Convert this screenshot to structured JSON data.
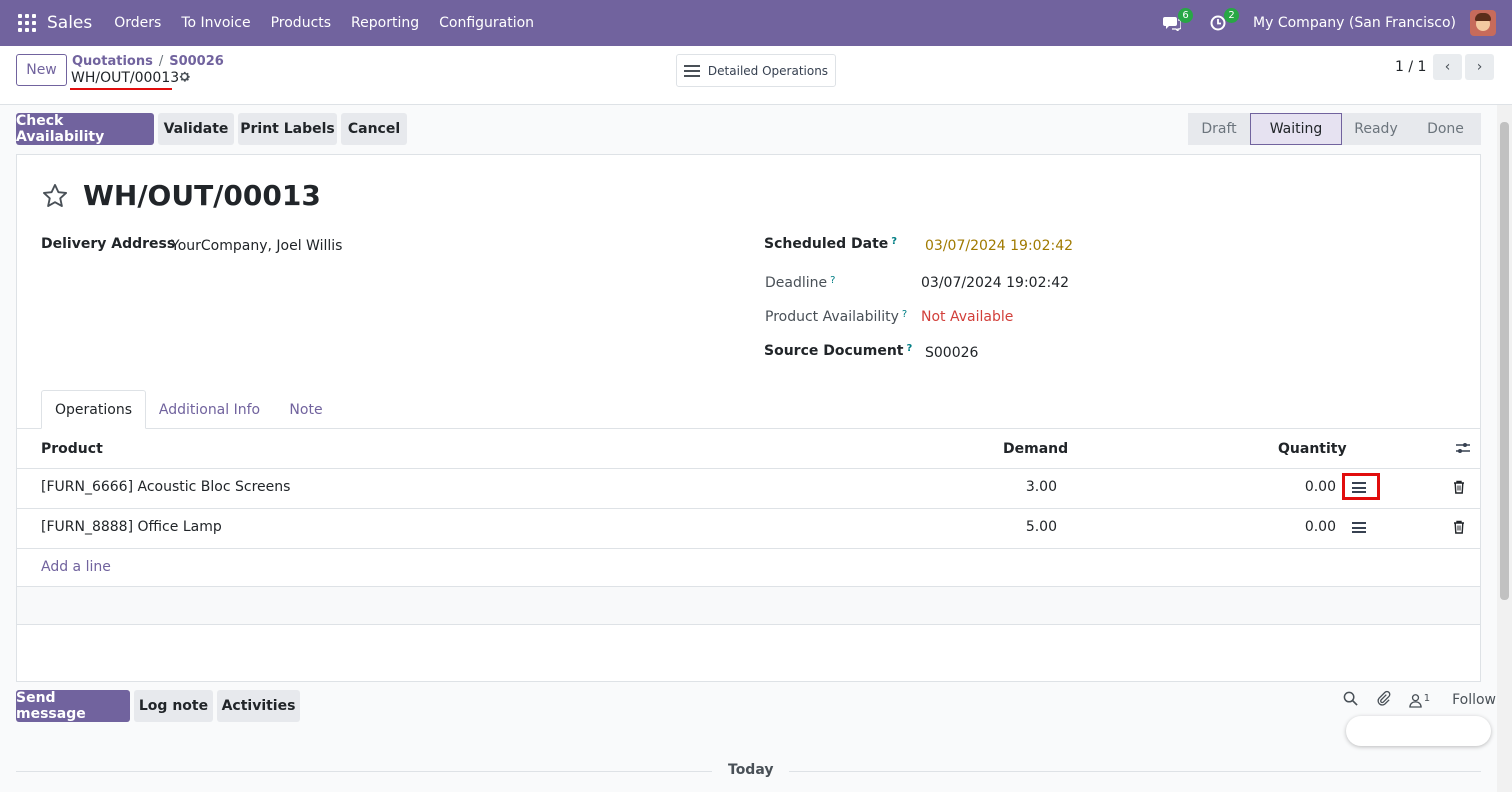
{
  "navbar": {
    "app_name": "Sales",
    "menu": [
      "Orders",
      "To Invoice",
      "Products",
      "Reporting",
      "Configuration"
    ],
    "messages_count": "6",
    "activities_count": "2",
    "company": "My Company (San Francisco)"
  },
  "control": {
    "new_label": "New",
    "breadcrumb": [
      "Quotations",
      "S00026"
    ],
    "breadcrumb_sep": "/",
    "record_name": "WH/OUT/00013",
    "detailed_operations_label": "Detailed Operations",
    "pager": "1 / 1"
  },
  "actions": {
    "check_availability": "Check Availability",
    "validate": "Validate",
    "print_labels": "Print Labels",
    "cancel": "Cancel"
  },
  "stages": [
    {
      "label": "Draft",
      "active": false
    },
    {
      "label": "Waiting",
      "active": true
    },
    {
      "label": "Ready",
      "active": false
    },
    {
      "label": "Done",
      "active": false
    }
  ],
  "form": {
    "title": "WH/OUT/00013",
    "delivery_address_label": "Delivery Address",
    "delivery_address": "YourCompany, Joel Willis",
    "scheduled_date_label": "Scheduled Date",
    "scheduled_date": "03/07/2024 19:02:42",
    "deadline_label": "Deadline",
    "deadline": "03/07/2024 19:02:42",
    "product_availability_label": "Product Availability",
    "product_availability": "Not Available",
    "source_document_label": "Source Document",
    "source_document": "S00026",
    "help_mark": "?"
  },
  "tabs": [
    "Operations",
    "Additional Info",
    "Note"
  ],
  "table": {
    "headers": {
      "product": "Product",
      "demand": "Demand",
      "quantity": "Quantity"
    },
    "rows": [
      {
        "product": "[FURN_6666] Acoustic Bloc Screens",
        "demand": "3.00",
        "quantity": "0.00"
      },
      {
        "product": "[FURN_8888] Office Lamp",
        "demand": "5.00",
        "quantity": "0.00"
      }
    ],
    "add_line": "Add a line"
  },
  "chatter": {
    "send_message": "Send message",
    "log_note": "Log note",
    "activities": "Activities",
    "followers_count": "1",
    "follow": "Follow",
    "today": "Today"
  },
  "colors": {
    "brand": "#71639e",
    "highlight": "#e10d0d",
    "warning_date": "#a07a00",
    "danger_text": "#d23f3a"
  }
}
